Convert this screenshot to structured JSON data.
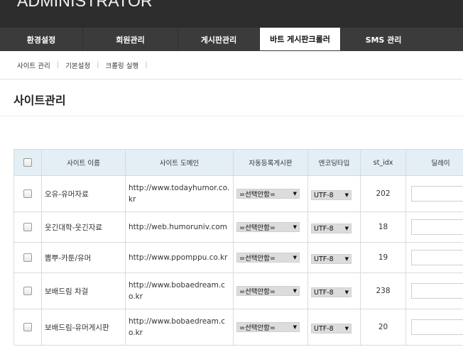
{
  "header": {
    "title": "ADMINISTRATOR"
  },
  "nav": {
    "tabs": [
      {
        "label": "환경설정",
        "active": false
      },
      {
        "label": "회원관리",
        "active": false
      },
      {
        "label": "게시판관리",
        "active": false
      },
      {
        "label": "바트 게시판크롤러",
        "active": true
      },
      {
        "label": "SMS 관리",
        "active": false
      }
    ]
  },
  "subnav": {
    "items": [
      "사이트 관리",
      "기본설정",
      "크롤링 실행"
    ]
  },
  "page": {
    "title": "사이트관리"
  },
  "table": {
    "headers": [
      "사이트 이름",
      "사이트 도메인",
      "자동등록게시판",
      "엔코딩타입",
      "st_idx",
      "딜레이"
    ],
    "rows": [
      {
        "name": "오유-유머자료",
        "domain": "http://www.todayhumor.co.kr",
        "auto_board": "=선택안함=",
        "encoding": "UTF-8",
        "st_idx": "202",
        "delay": ""
      },
      {
        "name": "웃긴대학-웃긴자료",
        "domain": "http://web.humoruniv.com",
        "auto_board": "=선택안함=",
        "encoding": "UTF-8",
        "st_idx": "18",
        "delay": ""
      },
      {
        "name": "뽐뿌-카툰/유머",
        "domain": "http://www.ppomppu.co.kr",
        "auto_board": "=선택안함=",
        "encoding": "UTF-8",
        "st_idx": "19",
        "delay": ""
      },
      {
        "name": "보배드림 차걸",
        "domain": "http://www.bobaedream.co.kr",
        "auto_board": "=선택안함=",
        "encoding": "UTF-8",
        "st_idx": "238",
        "delay": ""
      },
      {
        "name": "보배드림-유머게시판",
        "domain": "http://www.bobaedream.co.kr",
        "auto_board": "=선택안함=",
        "encoding": "UTF-8",
        "st_idx": "20",
        "delay": ""
      }
    ]
  },
  "colors": {
    "topbar": "#2d2d2d",
    "nav": "#3b3b3b",
    "table_header": "#e3eef5"
  },
  "icons": {
    "select_arrow": "triangle-down-icon"
  }
}
